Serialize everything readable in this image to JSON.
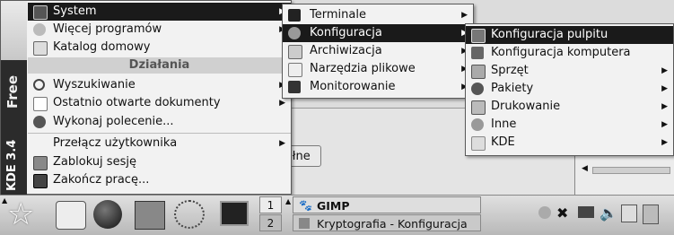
{
  "kmenu": {
    "items_top": [
      {
        "label": "System",
        "icon": "system-icon"
      },
      {
        "label": "Więcej programów",
        "icon": "more-programs-icon"
      },
      {
        "label": "Katalog domowy",
        "icon": "home-icon"
      }
    ],
    "section_title": "Działania",
    "actions": [
      {
        "label": "Wyszukiwanie",
        "icon": "search-icon"
      },
      {
        "label": "Ostatnio otwarte dokumenty",
        "icon": "recent-documents-icon"
      },
      {
        "label": "Wykonaj polecenie...",
        "icon": "run-command-icon"
      },
      {
        "label": "Przełącz użytkownika",
        "icon": "switch-user-icon"
      },
      {
        "label": "Zablokuj sesję",
        "icon": "lock-icon"
      },
      {
        "label": "Zakończ pracę...",
        "icon": "logout-icon"
      }
    ],
    "side_text_free": "Free",
    "side_text_kde": "KDE 3.4"
  },
  "system_menu": {
    "items": [
      {
        "label": "Terminale",
        "icon": "terminal-icon"
      },
      {
        "label": "Konfiguracja",
        "icon": "configuration-icon"
      },
      {
        "label": "Archiwizacja",
        "icon": "archive-icon"
      },
      {
        "label": "Narzędzia plikowe",
        "icon": "file-tools-icon"
      },
      {
        "label": "Monitorowanie",
        "icon": "monitor-icon"
      }
    ]
  },
  "config_menu": {
    "items": [
      {
        "label": "Konfiguracja pulpitu",
        "icon": "desktop-config-icon"
      },
      {
        "label": "Konfiguracja komputera",
        "icon": "computer-config-icon"
      },
      {
        "label": "Sprzęt",
        "icon": "hardware-icon"
      },
      {
        "label": "Pakiety",
        "icon": "packages-icon"
      },
      {
        "label": "Drukowanie",
        "icon": "printer-icon"
      },
      {
        "label": "Inne",
        "icon": "other-icon"
      },
      {
        "label": "KDE",
        "icon": "kde-icon"
      }
    ]
  },
  "background": {
    "partial_button": "śłne"
  },
  "taskbar": {
    "pager": [
      "1",
      "2"
    ],
    "tasks": [
      {
        "label": "GIMP",
        "icon": "gimp-icon"
      },
      {
        "label": "Kryptografia - Konfiguracja",
        "icon": "config-window-icon"
      }
    ],
    "launchers": [
      "kmenu-icon",
      "kde-home-icon",
      "globe-icon",
      "calendar-icon",
      "network-icon",
      "terminal-launcher-icon"
    ],
    "tray": [
      "help-icon",
      "tools-icon",
      "mail-icon",
      "volume-icon",
      "clipboard-icon",
      "printer-tray-icon"
    ]
  }
}
